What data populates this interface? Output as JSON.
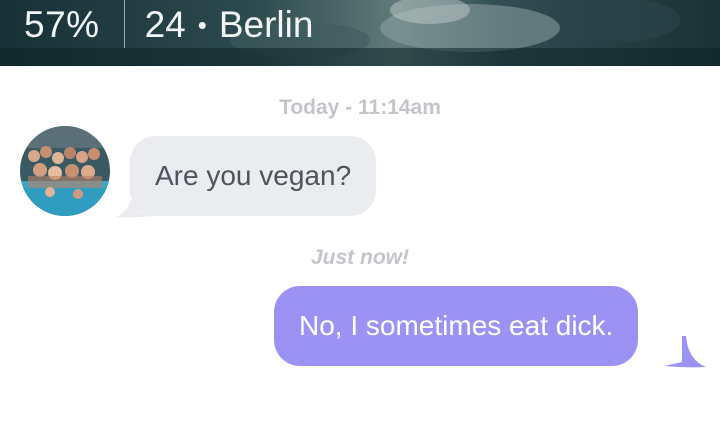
{
  "header": {
    "match_percent": "57%",
    "age": "24",
    "separator": "•",
    "city": "Berlin"
  },
  "conversation": {
    "timestamp_first": "Today - 11:14am",
    "incoming_message": "Are you vegan?",
    "timestamp_second": "Just now!",
    "outgoing_message": "No, I sometimes eat dick."
  },
  "colors": {
    "incoming_bubble": "#ebecf0",
    "outgoing_bubble": "#9c92f4",
    "timestamp_text": "#c4c5cc"
  }
}
